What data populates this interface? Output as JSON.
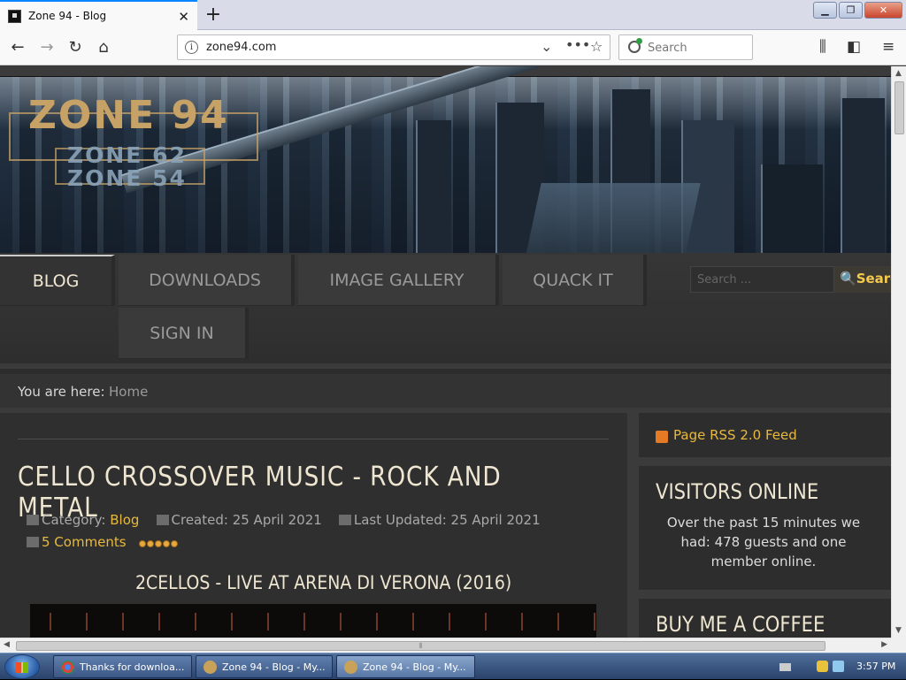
{
  "browser": {
    "tab_title": "Zone 94 - Blog",
    "url": "zone94.com",
    "search_placeholder": "Search",
    "window_buttons": {
      "minimize": "▁",
      "restore": "❐",
      "close": "✕"
    }
  },
  "site": {
    "logo": {
      "main": "ZONE 94",
      "sub1": "ZONE 62",
      "sub2": "ZONE 54"
    },
    "menu": [
      "BLOG",
      "DOWNLOADS",
      "IMAGE GALLERY",
      "QUACK IT",
      "SIGN IN"
    ],
    "search_placeholder": "Search ...",
    "search_button": "Search",
    "breadcrumb_label": "You are here:",
    "breadcrumb_home": "Home"
  },
  "article": {
    "title": "CELLO CROSSOVER MUSIC - ROCK AND METAL",
    "category_label": "Category:",
    "category": "Blog",
    "created": "Created: 25 April 2021",
    "updated": "Last Updated: 25 April 2021",
    "comments": "5 Comments",
    "rating": 5,
    "subtitle": "2CELLOS - LIVE AT ARENA DI VERONA (2016)"
  },
  "sidebar": {
    "rss": "Page RSS 2.0 Feed",
    "visitors_title": "VISITORS ONLINE",
    "visitors_text": "Over the past 15 minutes we had: 478 guests and one member online.",
    "coffee_title": "BUY ME A COFFEE"
  },
  "taskbar": {
    "items": [
      "Thanks for downloa...",
      "Zone 94 - Blog - My...",
      "Zone 94 - Blog - My..."
    ],
    "clock": "3:57 PM"
  },
  "colors": {
    "accent": "#e8b93d",
    "menu_text": "#9a9a9a",
    "heading": "#efe6d1",
    "page_bg": "#3b3b3b"
  }
}
